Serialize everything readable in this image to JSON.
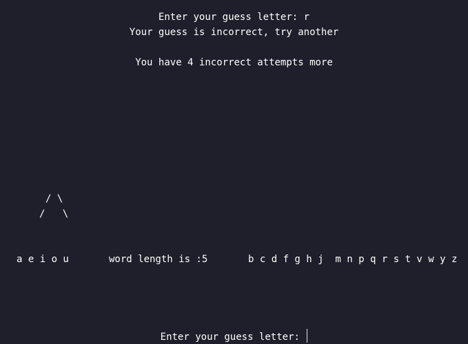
{
  "prompt_line": "Enter your guess letter: r",
  "feedback": "Your guess is incorrect, try another",
  "attempts_line": "You have 4 incorrect attempts more",
  "hangman": {
    "legs_top": "/ \\",
    "legs_bottom": "/   \\"
  },
  "vowels": "a e i o u",
  "word_length": "word length is :5",
  "consonants": "b c d f g h j  m n p q r s t v w y z",
  "input_prompt": "Enter your guess letter: ",
  "input_value": ""
}
